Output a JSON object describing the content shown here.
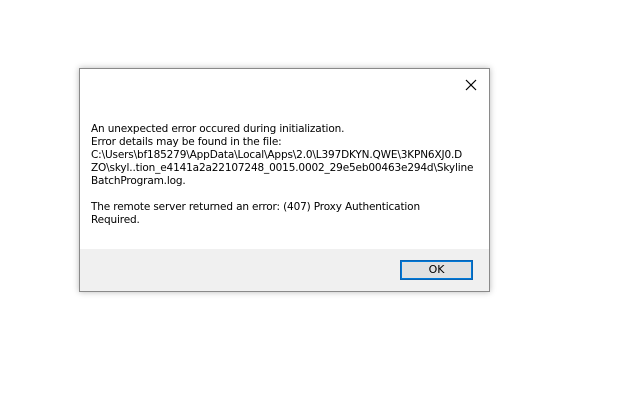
{
  "dialog": {
    "close_icon": "close-icon",
    "message_lines": [
      "An unexpected error occured during initialization.",
      "Error details may be found in the file:",
      "C:\\Users\\bf185279\\AppData\\Local\\Apps\\2.0\\L397DKYN.QWE\\3KPN6XJ0.D",
      "ZO\\skyl..tion_e4141a2a22107248_0015.0002_29e5eb00463e294d\\Skyline",
      "BatchProgram.log."
    ],
    "detail_lines": [
      "The remote server returned an error: (407) Proxy Authentication",
      "Required."
    ],
    "ok_label": "OK"
  },
  "colors": {
    "footer_bg": "#f0f0f0",
    "button_border": "#0078d7",
    "dialog_border": "#8a8a8a"
  }
}
